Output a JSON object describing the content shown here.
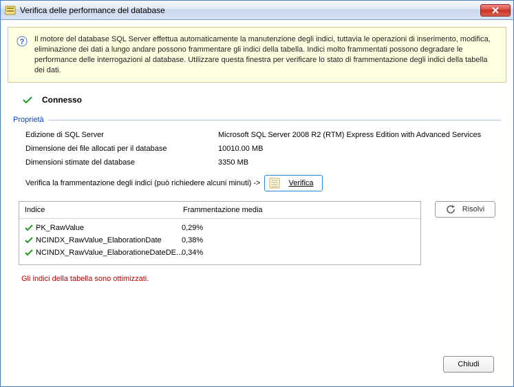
{
  "window": {
    "title": "Verifica delle performance del database"
  },
  "info": {
    "text": "Il motore del database SQL Server effettua automaticamente la manutenzione degli indici, tuttavia le operazioni di inserimento, modifica, eliminazione dei dati a lungo andare possono frammentare gli indici della tabella. Indici molto frammentati possono degradare le performance delle interrogazioni al database. Utilizzare questa finestra per verificare lo stato di frammentazione degli indici della tabella dei dati."
  },
  "status": {
    "label": "Connesso"
  },
  "props": {
    "header": "Proprietà",
    "rows": [
      {
        "label": "Edizione di SQL Server",
        "value": "Microsoft SQL Server 2008 R2 (RTM)  Express Edition with Advanced Services"
      },
      {
        "label": "Dimensione dei file allocati per il database",
        "value": "10010.00 MB"
      },
      {
        "label": "Dimensioni stimate del database",
        "value": "3350 MB"
      }
    ]
  },
  "verify": {
    "prompt": "Verifica la frammentazione degli indici (può richiedere alcuni minuti)  ->",
    "button": "Verifica"
  },
  "indices": {
    "col1": "Indice",
    "col2": "Frammentazione media",
    "rows": [
      {
        "name": "PK_RawValue",
        "frag": "0,29%"
      },
      {
        "name": "NCINDX_RawValue_ElaborationDate",
        "frag": "0,38%"
      },
      {
        "name": "NCINDX_RawValue_ElaborationeDateDE...",
        "frag": "0,34%"
      }
    ]
  },
  "resolve": {
    "label": "Risolvi"
  },
  "optimized": "Gli indici della tabella sono ottimizzati.",
  "footer": {
    "close": "Chiudi"
  }
}
